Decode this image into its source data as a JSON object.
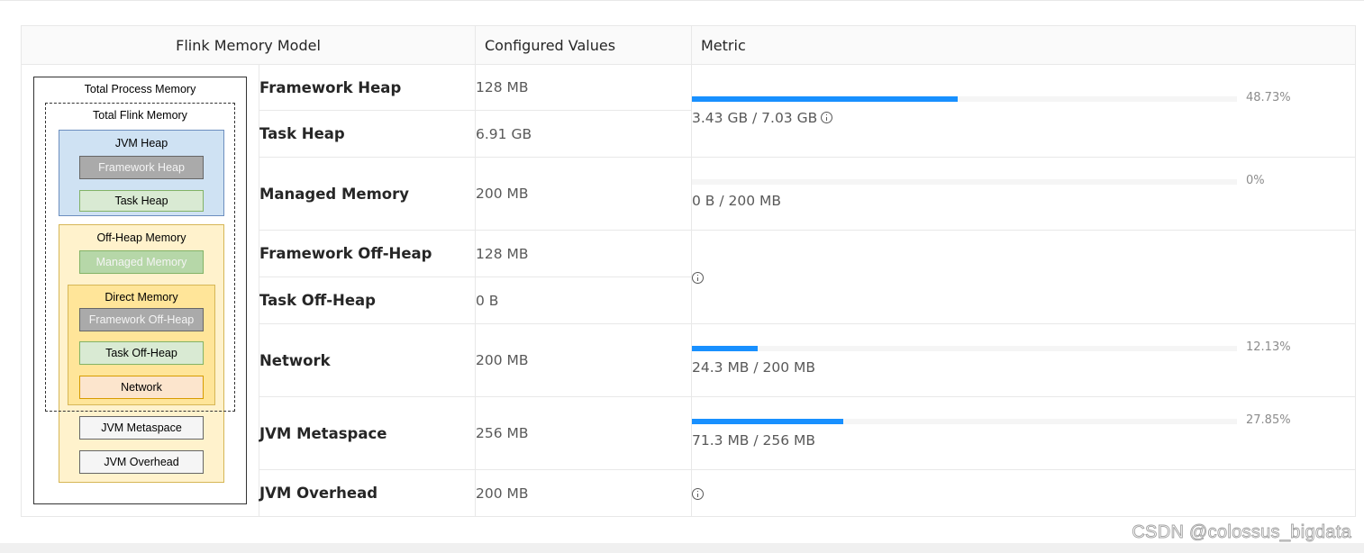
{
  "table": {
    "headers": {
      "model": "Flink Memory Model",
      "configured": "Configured Values",
      "metric": "Metric"
    },
    "rows": [
      {
        "label": "Framework Heap",
        "value": "128 MB"
      },
      {
        "label": "Task Heap",
        "value": "6.91 GB"
      },
      {
        "label": "Managed Memory",
        "value": "200 MB"
      },
      {
        "label": "Framework Off-Heap",
        "value": "128 MB"
      },
      {
        "label": "Task Off-Heap",
        "value": "0 B"
      },
      {
        "label": "Network",
        "value": "200 MB"
      },
      {
        "label": "JVM Metaspace",
        "value": "256 MB"
      },
      {
        "label": "JVM Overhead",
        "value": "200 MB"
      }
    ],
    "metrics": {
      "heap": {
        "percent_label": "48.73%",
        "percent": 48.73,
        "text": "3.43 GB / 7.03 GB",
        "has_info": true
      },
      "managed": {
        "percent_label": "0%",
        "percent": 0,
        "text": "0 B / 200 MB"
      },
      "offheap": {
        "info_only": true
      },
      "network": {
        "percent_label": "12.13%",
        "percent": 12.13,
        "text": "24.3 MB / 200 MB"
      },
      "metaspace": {
        "percent_label": "27.85%",
        "percent": 27.85,
        "text": "71.3 MB / 256 MB"
      },
      "overhead": {
        "info_only": true
      }
    }
  },
  "diagram": {
    "total_process": "Total Process Memory",
    "total_flink": "Total Flink Memory",
    "jvm_heap": "JVM Heap",
    "framework_heap": "Framework Heap",
    "task_heap": "Task Heap",
    "off_heap": "Off-Heap Memory",
    "managed_memory": "Managed Memory",
    "direct_memory": "Direct Memory",
    "framework_off_heap": "Framework Off-Heap",
    "task_off_heap": "Task Off-Heap",
    "network": "Network",
    "jvm_metaspace": "JVM Metaspace",
    "jvm_overhead": "JVM Overhead"
  },
  "colors": {
    "accent": "#1890ff",
    "heap_bg": "#cfe2f3",
    "heap_border": "#6c8ebf",
    "offheap_bg": "#fff2cc",
    "offheap_border": "#d6b656",
    "direct_bg": "#ffe599",
    "gray_box": "#aaaaaa",
    "green_box": "#d9ead3",
    "green_box_dark": "#b6d7a8",
    "network_box": "#fce5cd"
  },
  "watermark": "CSDN @colossus_bigdata"
}
